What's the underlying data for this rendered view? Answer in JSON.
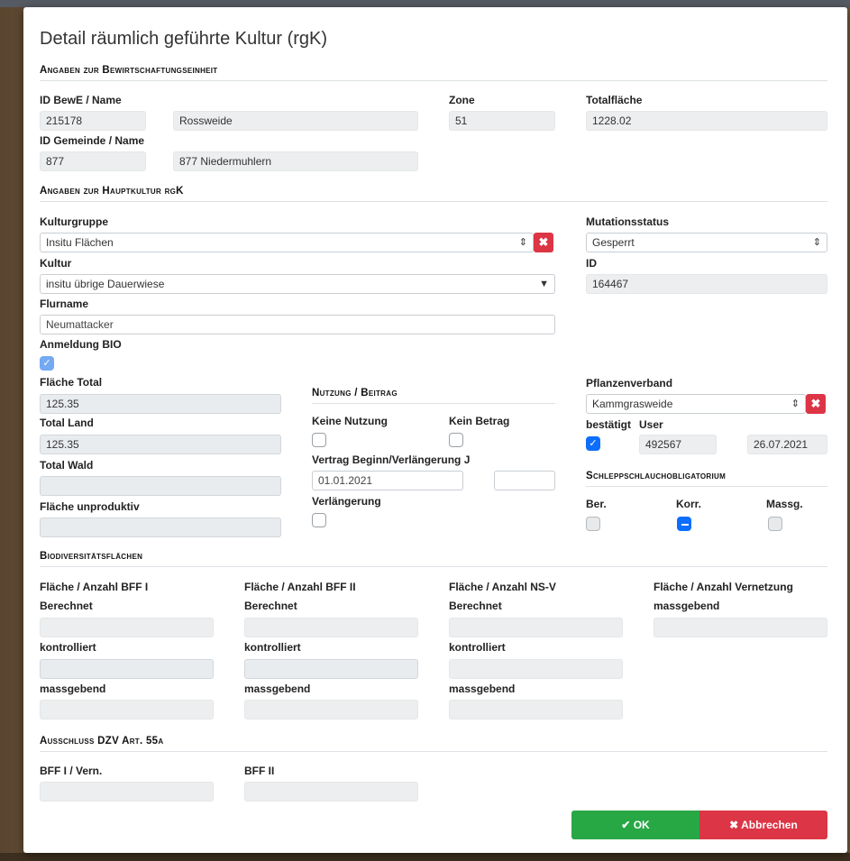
{
  "dialog": {
    "title": "Detail räumlich geführte Kultur (rgK)"
  },
  "bewe": {
    "section": "Angaben zur Bewirtschaftungseinheit",
    "id_name_label": "ID BewE / Name",
    "id": "215178",
    "name": "Rossweide",
    "zone_label": "Zone",
    "zone": "51",
    "total_label": "Totalfläche",
    "total": "1228.02",
    "gemeinde_label": "ID Gemeinde / Name",
    "gemeinde_id": "877",
    "gemeinde_name": "877 Niedermuhlern"
  },
  "haupt": {
    "section": "Angaben zur Hauptkultur rgK",
    "kulturgruppe_label": "Kulturgruppe",
    "kulturgruppe": "Insitu Flächen",
    "mutation_label": "Mutationsstatus",
    "mutation": "Gesperrt",
    "kultur_label": "Kultur",
    "kultur": "insitu übrige Dauerwiese",
    "id_label": "ID",
    "id": "164467",
    "flurname_label": "Flurname",
    "flurname": "Neumattacker",
    "bio_label": "Anmeldung BIO",
    "bio_checked": true,
    "flaeche_total_label": "Fläche Total",
    "flaeche_total": "125.35",
    "total_land_label": "Total Land",
    "total_land": "125.35",
    "total_wald_label": "Total Wald",
    "total_wald": "",
    "unproduktiv_label": "Fläche unproduktiv",
    "unproduktiv": ""
  },
  "nutzung": {
    "section": "Nutzung / Beitrag",
    "keine_nutzung_label": "Keine Nutzung",
    "kein_betrag_label": "Kein Betrag",
    "vertrag_label": "Vertrag Beginn/Verlängerung J",
    "vertrag_date": "01.01.2021",
    "vertrag_j": "",
    "verlaengerung_label": "Verlängerung"
  },
  "pflanzen": {
    "label": "Pflanzenverband",
    "value": "Kammgrasweide",
    "bestaetigt_label": "bestätigt",
    "user_label": "User",
    "user": "492567",
    "date": "26.07.2021"
  },
  "schlepp": {
    "section": "Schleppschlauchobligatorium",
    "ber_label": "Ber.",
    "korr_label": "Korr.",
    "massg_label": "Massg."
  },
  "bio": {
    "section": "Biodiversitätsflächen",
    "col1": "Fläche / Anzahl BFF I",
    "col2": "Fläche / Anzahl BFF II",
    "col3": "Fläche / Anzahl NS-V",
    "col4": "Fläche / Anzahl Vernetzung",
    "berechnet": "Berechnet",
    "kontrolliert": "kontrolliert",
    "massgebend": "massgebend"
  },
  "ausschluss": {
    "section": "Ausschluss DZV Art. 55a",
    "bff1_label": "BFF I / Vern.",
    "bff2_label": "BFF II"
  },
  "actions": {
    "ok": "OK",
    "cancel": "Abbrechen"
  },
  "icons": {
    "check": "check-icon",
    "close": "close-icon",
    "sort": "sort-arrows-icon",
    "caret": "caret-down-icon"
  },
  "colors": {
    "ok": "#28a745",
    "danger": "#dc3545",
    "primary": "#0d6efd"
  }
}
